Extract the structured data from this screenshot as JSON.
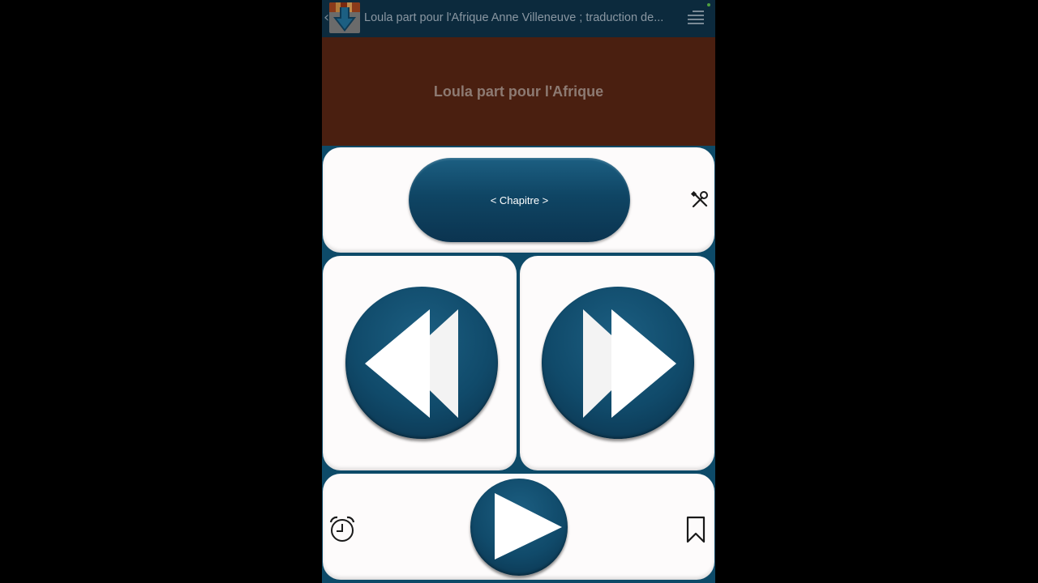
{
  "action_bar": {
    "back_icon": "chevron-left-icon",
    "app_icon": "download-books-icon",
    "title": "Loula part pour l'Afrique Anne Villeneuve ; traduction de...",
    "menu_icon": "menu-lines-icon"
  },
  "banner": {
    "title": "Loula part pour l'Afrique"
  },
  "chapter": {
    "label": "< Chapitre >",
    "settings_icon": "tools-icon"
  },
  "controls": {
    "rewind_icon": "rewind-icon",
    "fast_forward_icon": "fast-forward-icon",
    "play_icon": "play-icon",
    "sleep_timer_icon": "alarm-clock-icon",
    "bookmark_icon": "bookmark-icon"
  },
  "colors": {
    "action_bar": "#0c2a3d",
    "banner": "#4a1f10",
    "accent": "#104a6a",
    "panel": "#fdfbfb",
    "background": "#0d4a68"
  }
}
